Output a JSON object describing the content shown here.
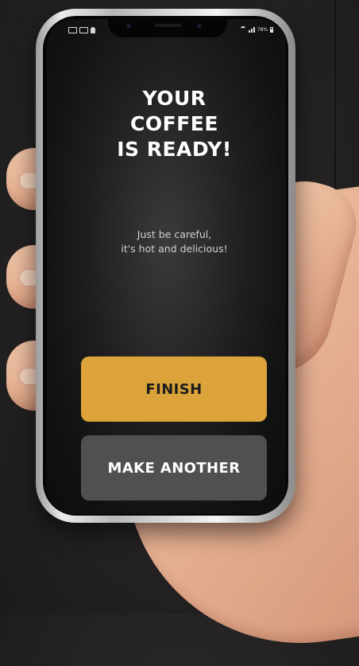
{
  "screen": {
    "title_lines": [
      "YOUR",
      "COFFEE",
      "IS READY!"
    ],
    "subtitle_lines": [
      "Just be careful,",
      "it's hot and delicious!"
    ]
  },
  "actions": {
    "finish_label": "FINISH",
    "make_another_label": "MAKE ANOTHER"
  },
  "status_bar": {
    "battery_text": "78%"
  },
  "colors": {
    "primary_button": "#dba33a",
    "secondary_button": "#505050",
    "screen_background": "#121212",
    "page_background": "#232121"
  }
}
